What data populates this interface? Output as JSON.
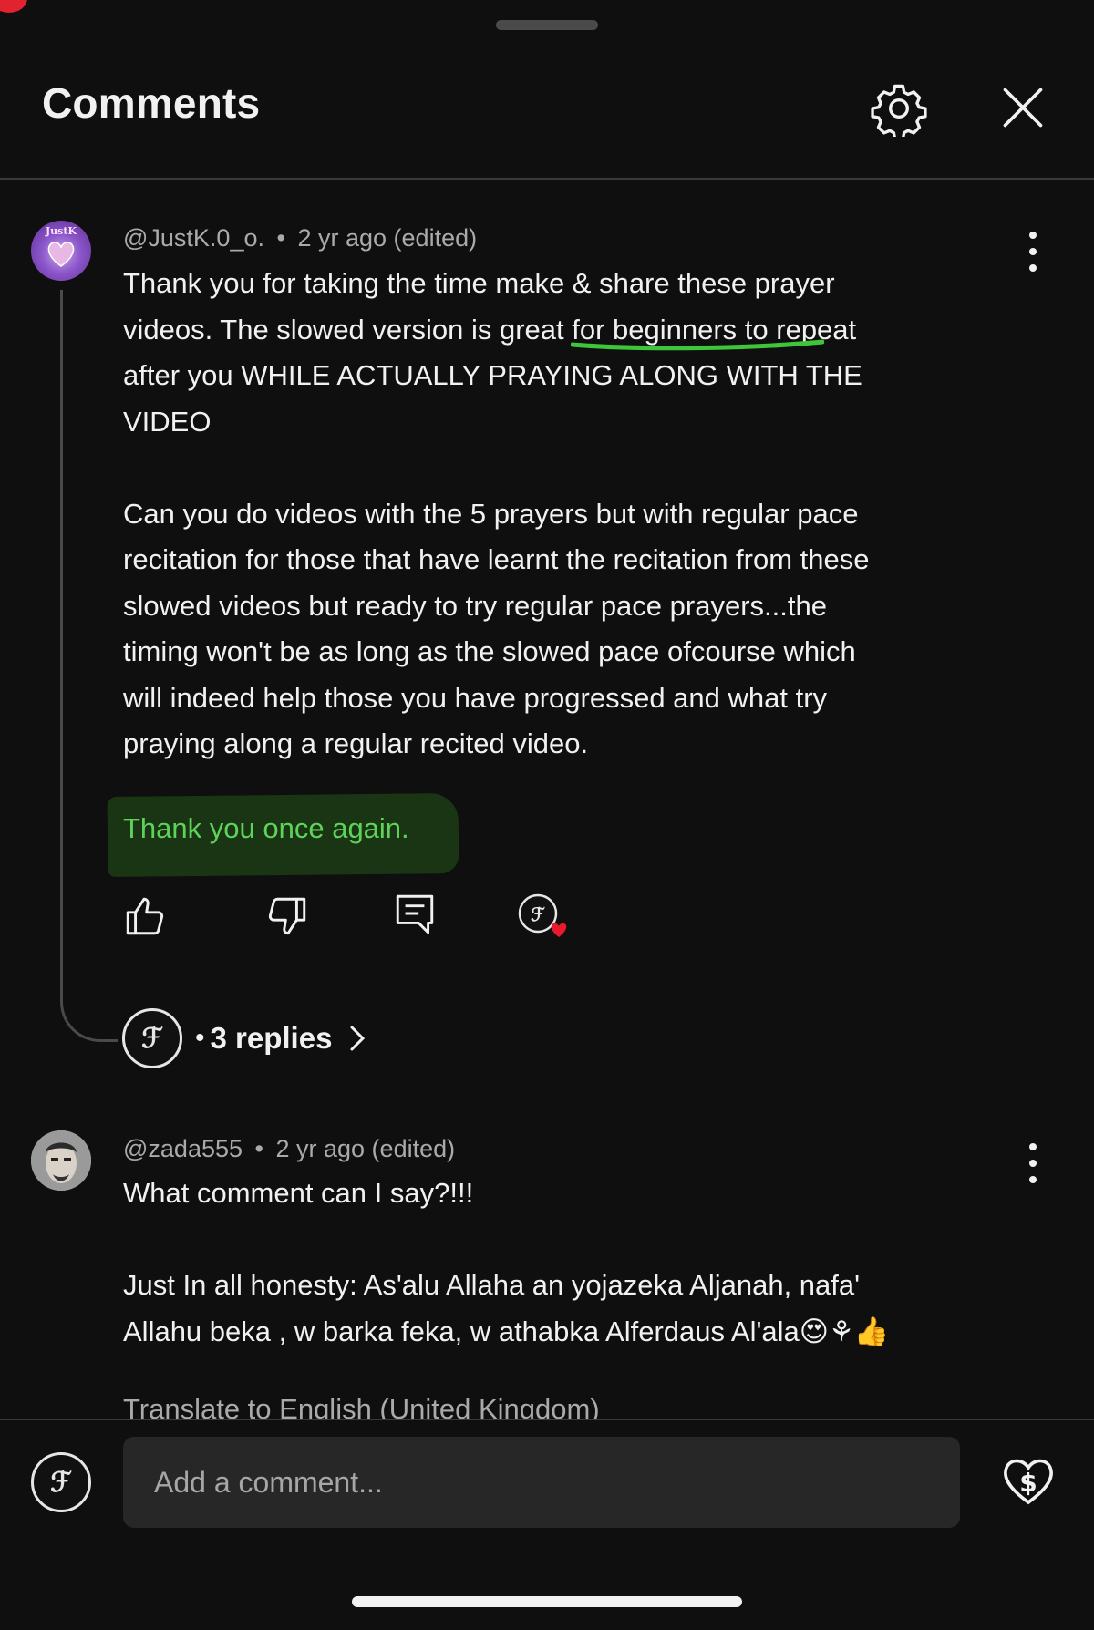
{
  "header": {
    "title": "Comments"
  },
  "comments": [
    {
      "author": "@JustK.0_o.",
      "separator": "•",
      "time": "2 yr ago (edited)",
      "avatar_text": "JustK",
      "lines": [
        "Thank you for taking the time make & share these prayer",
        "videos. The slowed version is great for beginners to repeat",
        "after you WHILE ACTUALLY PRAYING ALONG WITH THE",
        "VIDEO",
        "",
        "Can you do videos with the 5 prayers but with regular pace",
        "recitation for those that have learnt the recitation from these",
        "slowed videos but ready to try regular pace prayers...the",
        "timing won't be as long as the slowed pace ofcourse which",
        "will indeed help those you have progressed and what try",
        "praying along a regular recited video."
      ],
      "highlighted_line": "Thank you once again.",
      "replies_separator": "•",
      "replies_label": "3 replies"
    },
    {
      "author": "@zada555",
      "separator": "•",
      "time": "2 yr ago (edited)",
      "lines": [
        "What comment can I say?!!!",
        "",
        "Just In all honesty: As'alu Allaha an yojazeka Aljanah, nafa'",
        "Allahu beka , w barka feka, w athabka Alferdaus Al'ala😍⚘👍"
      ],
      "translate_label": "Translate to English (United Kingdom)"
    }
  ],
  "footer": {
    "placeholder": "Add a comment..."
  },
  "colors": {
    "background": "#0f0f0f",
    "highlight_green": "#5ed25b",
    "heart_red": "#e8192c",
    "input_bg": "#272727"
  }
}
